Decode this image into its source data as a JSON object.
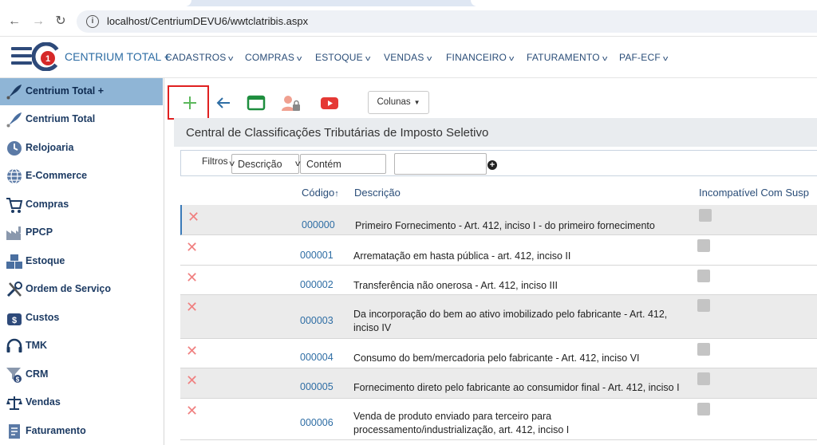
{
  "browser": {
    "url": "localhost/CentriumDEVU6/wwtclatribis.aspx"
  },
  "header": {
    "brand": "CENTRIUM TOTAL +",
    "menu": [
      "CADASTROS",
      "COMPRAS",
      "ESTOQUE",
      "VENDAS",
      "FINANCEIRO",
      "FATURAMENTO",
      "PAF-ECF"
    ]
  },
  "sidebar": {
    "items": [
      {
        "label": "Centrium Total +",
        "icon": "rocket-icon",
        "active": true
      },
      {
        "label": "Centrium Total",
        "icon": "rocket-icon",
        "active": false
      },
      {
        "label": "Relojoaria",
        "icon": "clock-icon",
        "active": false
      },
      {
        "label": "E-Commerce",
        "icon": "globe-icon",
        "active": false
      },
      {
        "label": "Compras",
        "icon": "cart-icon",
        "active": false
      },
      {
        "label": "PPCP",
        "icon": "factory-icon",
        "active": false
      },
      {
        "label": "Estoque",
        "icon": "boxes-icon",
        "active": false
      },
      {
        "label": "Ordem de Serviço",
        "icon": "tools-icon",
        "active": false
      },
      {
        "label": "Custos",
        "icon": "money-bag-icon",
        "active": false
      },
      {
        "label": "TMK",
        "icon": "headset-icon",
        "active": false
      },
      {
        "label": "CRM",
        "icon": "funnel-icon",
        "active": false
      },
      {
        "label": "Vendas",
        "icon": "scales-icon",
        "active": false
      },
      {
        "label": "Faturamento",
        "icon": "invoice-icon",
        "active": false
      }
    ]
  },
  "toolbar": {
    "colunas_label": "Colunas"
  },
  "page": {
    "title": "Central de Classificações Tributárias de Imposto Seletivo"
  },
  "filters": {
    "label": "Filtros",
    "field": "Descrição",
    "operator": "Contém",
    "value": ""
  },
  "table": {
    "columns": [
      "Código",
      "Descrição",
      "Incompatível Com Susp"
    ],
    "rows": [
      {
        "code": "000000",
        "desc": "Primeiro Fornecimento - Art. 412, inciso I - do primeiro fornecimento"
      },
      {
        "code": "000001",
        "desc": "Arrematação em hasta pública - art. 412, inciso II"
      },
      {
        "code": "000002",
        "desc": "Transferência não onerosa - Art. 412, inciso III"
      },
      {
        "code": "000003",
        "desc": "Da incorporação do bem ao ativo imobilizado pelo fabricante - Art. 412, inciso IV"
      },
      {
        "code": "000004",
        "desc": "Consumo do bem/mercadoria pelo fabricante - Art. 412, inciso VI"
      },
      {
        "code": "000005",
        "desc": "Fornecimento direto pelo fabricante ao consumidor final - Art. 412, inciso I"
      },
      {
        "code": "000006",
        "desc": "Venda de produto enviado para terceiro para processamento/industrialização, art. 412, inciso I"
      }
    ]
  },
  "colors": {
    "accent": "#2e6da4",
    "sidebar_active": "#8fb5d6",
    "highlight": "#e02020",
    "delete": "#f08080"
  }
}
